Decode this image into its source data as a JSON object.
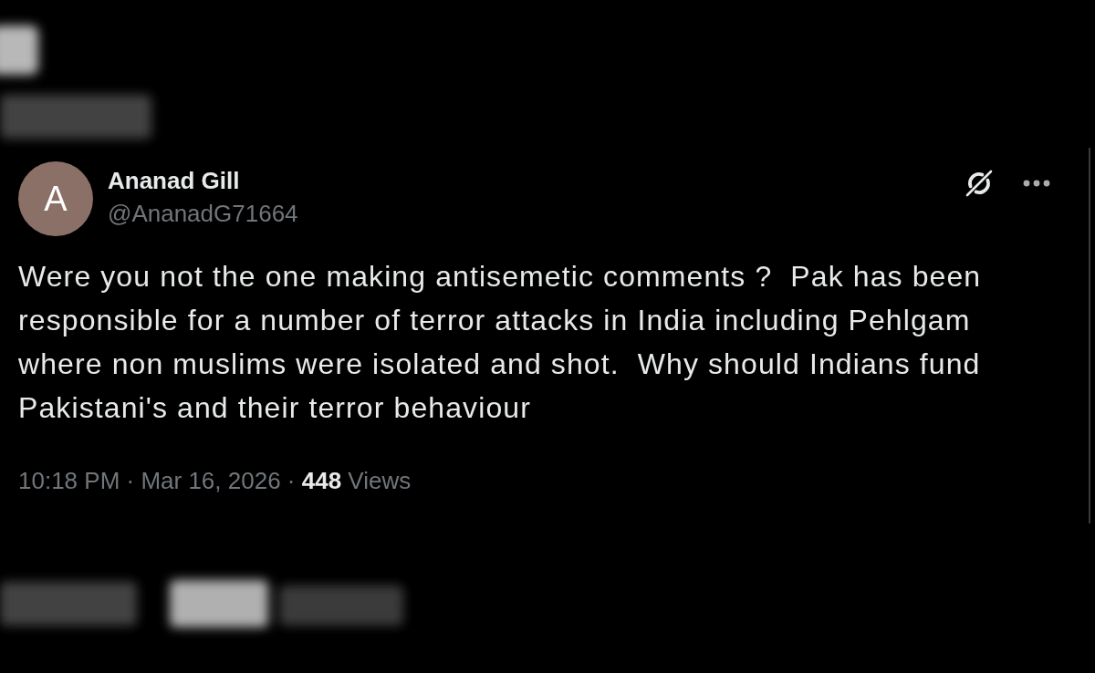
{
  "post": {
    "author": {
      "avatar_letter": "A",
      "name": "Ananad Gill",
      "handle": "@AnanadG71664"
    },
    "text": "Were you not the one making antisemetic comments ?  Pak has been responsible for a number of terror attacks in India including Pehlgam where non muslims were isolated and shot.  Why should Indians fund Pakistani's and their terror behaviour",
    "meta": "10:18 PM · Mar 16, 2026 · **448** Views"
  }
}
